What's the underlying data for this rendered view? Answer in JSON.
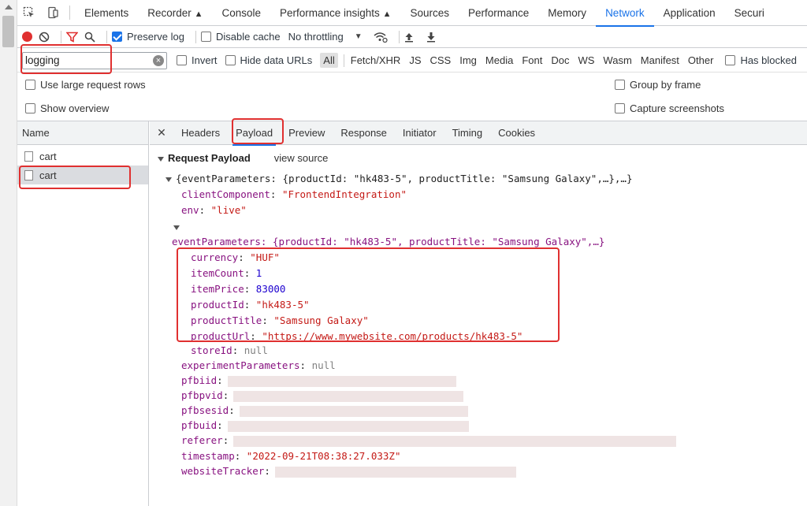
{
  "devtools_tabs": [
    "Elements",
    "Recorder",
    "Console",
    "Performance insights",
    "Sources",
    "Performance",
    "Memory",
    "Network",
    "Application",
    "Securi"
  ],
  "active_tab": "Network",
  "toolbar": {
    "preserve_log": "Preserve log",
    "disable_cache": "Disable cache",
    "throttling": "No throttling"
  },
  "filter": {
    "value": "logging",
    "invert": "Invert",
    "hide_data_urls": "Hide data URLs",
    "types": [
      "All",
      "Fetch/XHR",
      "JS",
      "CSS",
      "Img",
      "Media",
      "Font",
      "Doc",
      "WS",
      "Wasm",
      "Manifest",
      "Other"
    ],
    "has_blocked": "Has blocked"
  },
  "options": {
    "large_rows": "Use large request rows",
    "group_by_frame": "Group by frame",
    "show_overview": "Show overview",
    "capture_screenshots": "Capture screenshots"
  },
  "requests": {
    "header": "Name",
    "items": [
      "cart",
      "cart"
    ]
  },
  "detail_tabs": [
    "Headers",
    "Payload",
    "Preview",
    "Response",
    "Initiator",
    "Timing",
    "Cookies"
  ],
  "active_detail_tab": "Payload",
  "payload": {
    "section_title": "Request Payload",
    "view_source": "view source",
    "summary": "{eventParameters: {productId: \"hk483-5\", productTitle: \"Samsung Galaxy\",…},…}",
    "client_component_key": "clientComponent",
    "client_component_val": "\"FrontendIntegration\"",
    "env_key": "env",
    "env_val": "\"live\"",
    "event_params_summary": "eventParameters: {productId: \"hk483-5\", productTitle: \"Samsung Galaxy\",…}",
    "currency_key": "currency",
    "currency_val": "\"HUF\"",
    "item_count_key": "itemCount",
    "item_count_val": "1",
    "item_price_key": "itemPrice",
    "item_price_val": "83000",
    "product_id_key": "productId",
    "product_id_val": "\"hk483-5\"",
    "product_title_key": "productTitle",
    "product_title_val": "\"Samsung Galaxy\"",
    "product_url_key": "productUrl",
    "product_url_val": "\"https://www.mywebsite.com/products/hk483-5\"",
    "store_id_key": "storeId",
    "store_id_val": "null",
    "experiment_key": "experimentParameters",
    "experiment_val": "null",
    "pfbiid_key": "pfbiid",
    "pfbpvid_key": "pfbpvid",
    "pfbsesid_key": "pfbsesid",
    "pfbuid_key": "pfbuid",
    "referer_key": "referer",
    "timestamp_key": "timestamp",
    "timestamp_val": "\"2022-09-21T08:38:27.033Z\"",
    "website_tracker_key": "websiteTracker"
  },
  "colors": {
    "accent": "#1a73e8",
    "highlight": "#e03030",
    "record": "#e03030"
  }
}
